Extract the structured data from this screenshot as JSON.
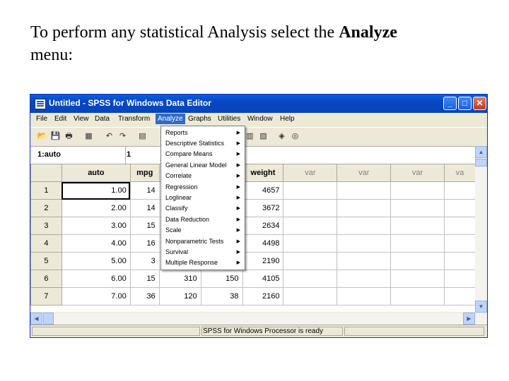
{
  "caption": {
    "prefix": "To perform any statistical Analysis select the ",
    "bold": "Analyze",
    "suffix": " menu:"
  },
  "window": {
    "title": "Untitled - SPSS for Windows Data Editor",
    "controls": {
      "minimize": "_",
      "maximize": "□",
      "close": "✕"
    }
  },
  "menubar": [
    "File",
    "Edit",
    "View",
    "Data",
    "Transform",
    "Analyze",
    "Graphs",
    "Utilities",
    "Window",
    "Help"
  ],
  "cell_editor": {
    "ref": "1:auto",
    "value": "1"
  },
  "grid": {
    "columns": [
      "auto",
      "mpg",
      "",
      "",
      "weight",
      "var",
      "var",
      "var",
      "va"
    ],
    "rows": [
      [
        "1",
        "1.00",
        "14",
        "",
        "",
        "4657"
      ],
      [
        "2",
        "2.00",
        "14",
        "",
        "",
        "3672"
      ],
      [
        "3",
        "3.00",
        "15",
        "",
        "",
        "2634"
      ],
      [
        "4",
        "4.00",
        "16",
        "",
        "",
        "4498"
      ],
      [
        "5",
        "5.00",
        "3",
        "",
        "",
        "2190"
      ],
      [
        "6",
        "6.00",
        "15",
        "310",
        "150",
        "4105"
      ],
      [
        "7",
        "7.00",
        "36",
        "120",
        "38",
        "2160"
      ]
    ]
  },
  "analyze_menu": [
    "Reports",
    "Descriptive Statistics",
    "Compare Means",
    "General Linear Model",
    "Correlate",
    "Regression",
    "Loglinear",
    "Classify",
    "Data Reduction",
    "Scale",
    "Nonparametric Tests",
    "Survival",
    "Multiple Response"
  ],
  "status": "SPSS for Windows Processor is ready",
  "colors": {
    "titlebar": "#0846c4",
    "menu_highlight": "#316ac5",
    "chrome": "#ece9d8"
  }
}
